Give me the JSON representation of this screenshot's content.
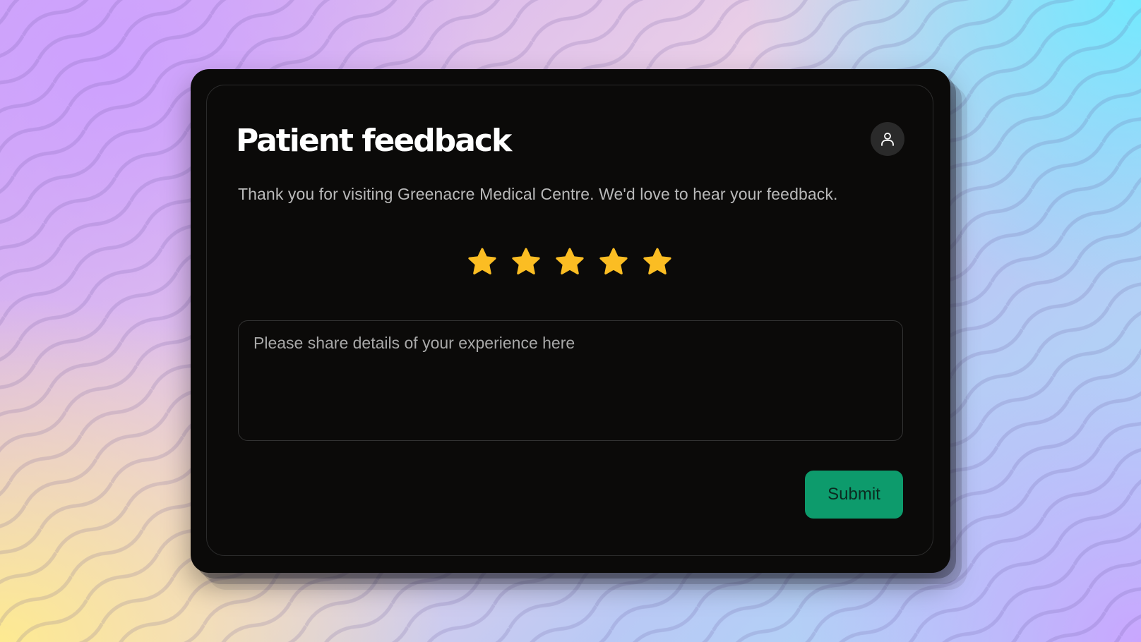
{
  "form": {
    "title": "Patient feedback",
    "subtitle": "Thank you for visiting Greenacre Medical Centre. We'd love to hear your feedback.",
    "rating": {
      "value": 5,
      "max": 5,
      "star_color": "#fbbd23"
    },
    "comment": {
      "value": "",
      "placeholder": "Please share details of your experience here"
    },
    "submit_label": "Submit"
  },
  "header": {
    "profile_icon": "user-icon"
  },
  "colors": {
    "card_background": "#0b0a09",
    "accent_green": "#0d9b6c",
    "title_text": "#ffffff",
    "body_text": "#b9b9b9"
  }
}
